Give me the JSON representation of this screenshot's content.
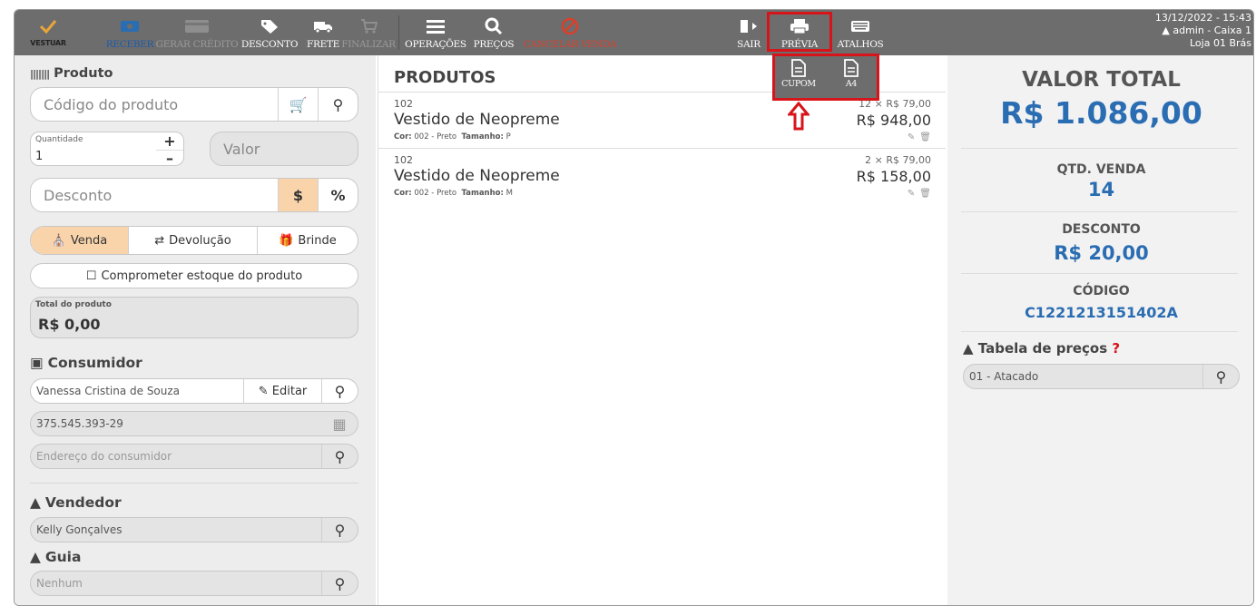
{
  "toolbar": {
    "logo_text": "VESTUAR",
    "buttons": [
      {
        "label": "RECEBER"
      },
      {
        "label": "GERAR CRÉDITO"
      },
      {
        "label": "DESCONTO"
      },
      {
        "label": "FRETE"
      },
      {
        "label": "FINALIZAR"
      },
      {
        "label": "OPERAÇÕES"
      },
      {
        "label": "PREÇOS"
      },
      {
        "label": "CANCELAR VENDA"
      },
      {
        "label": "SAIR"
      },
      {
        "label": "PRÉVIA"
      },
      {
        "label": "ATALHOS"
      }
    ],
    "clock": {
      "datetime": "13/12/2022 - 15:43",
      "user": "admin - Caixa 1",
      "store": "Loja 01 Brás"
    }
  },
  "preview_menu": {
    "cupom": "CUPOM",
    "a4": "A4"
  },
  "left": {
    "produto_title": "Produto",
    "codigo_placeholder": "Código do produto",
    "quantidade_label": "Quantidade",
    "quantidade_value": "1",
    "valor_placeholder": "Valor",
    "desconto_placeholder": "Desconto",
    "desconto_currency": "$",
    "desconto_percent": "%",
    "tipo": {
      "venda": "Venda",
      "devolucao": "Devolução",
      "brinde": "Brinde"
    },
    "comprometer_label": "Comprometer estoque do produto",
    "total_produto_label": "Total do produto",
    "total_produto_value": "R$ 0,00",
    "consumidor_title": "Consumidor",
    "consumidor_name": "Vanessa Cristina de Souza",
    "editar_label": "Editar",
    "consumidor_doc": "375.545.393-29",
    "endereco_placeholder": "Endereço do consumidor",
    "vendedor_title": "Vendedor",
    "vendedor_value": "Kelly Gonçalves",
    "guia_title": "Guia",
    "guia_placeholder": "Nenhum"
  },
  "center": {
    "title": "PRODUTOS",
    "items": [
      {
        "code": "102",
        "name": "Vestido de Neopreme",
        "cor_label": "Cor:",
        "cor": "002 - Preto",
        "tam_label": "Tamanho:",
        "tam": "P",
        "unit": "12 × R$ 79,00",
        "total": "R$ 948,00"
      },
      {
        "code": "102",
        "name": "Vestido de Neopreme",
        "cor_label": "Cor:",
        "cor": "002 - Preto",
        "tam_label": "Tamanho:",
        "tam": "M",
        "unit": "2 × R$ 79,00",
        "total": "R$ 158,00"
      }
    ]
  },
  "right": {
    "valor_total_label": "VALOR TOTAL",
    "valor_total": "R$ 1.086,00",
    "qtd_label": "QTD. VENDA",
    "qtd": "14",
    "desconto_label": "DESCONTO",
    "desconto": "R$ 20,00",
    "codigo_label": "CÓDIGO",
    "codigo": "C1221213151402A",
    "tabela_label": "Tabela de preços",
    "tabela_help": "?",
    "tabela_value": "01 - Atacado"
  },
  "colors": {
    "toolbar": "#6d6d6d",
    "accent_blue": "#2a6db2",
    "highlight_red": "#d7141a",
    "venda_active": "#f9d4ab"
  }
}
